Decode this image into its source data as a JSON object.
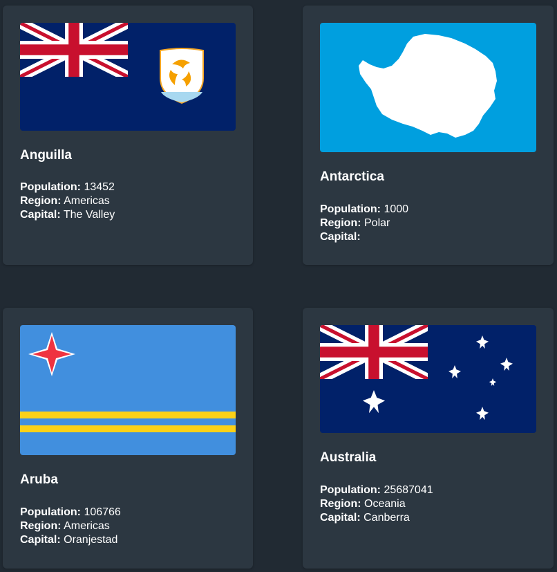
{
  "countries": [
    {
      "name": "Anguilla",
      "flag_icon": "anguilla-flag",
      "population_label": "Population:",
      "population": "13452",
      "region_label": "Region:",
      "region": "Americas",
      "capital_label": "Capital:",
      "capital": "The Valley"
    },
    {
      "name": "Antarctica",
      "flag_icon": "antarctica-flag",
      "population_label": "Population:",
      "population": "1000",
      "region_label": "Region:",
      "region": "Polar",
      "capital_label": "Capital:",
      "capital": ""
    },
    {
      "name": "Aruba",
      "flag_icon": "aruba-flag",
      "population_label": "Population:",
      "population": "106766",
      "region_label": "Region:",
      "region": "Americas",
      "capital_label": "Capital:",
      "capital": "Oranjestad"
    },
    {
      "name": "Australia",
      "flag_icon": "australia-flag",
      "population_label": "Population:",
      "population": "25687041",
      "region_label": "Region:",
      "region": "Oceania",
      "capital_label": "Capital:",
      "capital": "Canberra"
    }
  ],
  "colors": {
    "page_background": "#212a33",
    "card_background": "#2c3741",
    "text": "#ffffff",
    "union_blue": "#012169",
    "union_red": "#c8102e",
    "antarctica_blue": "#009fdf",
    "aruba_blue": "#418fde",
    "aruba_yellow": "#fbd116",
    "aruba_red": "#ef3340"
  }
}
